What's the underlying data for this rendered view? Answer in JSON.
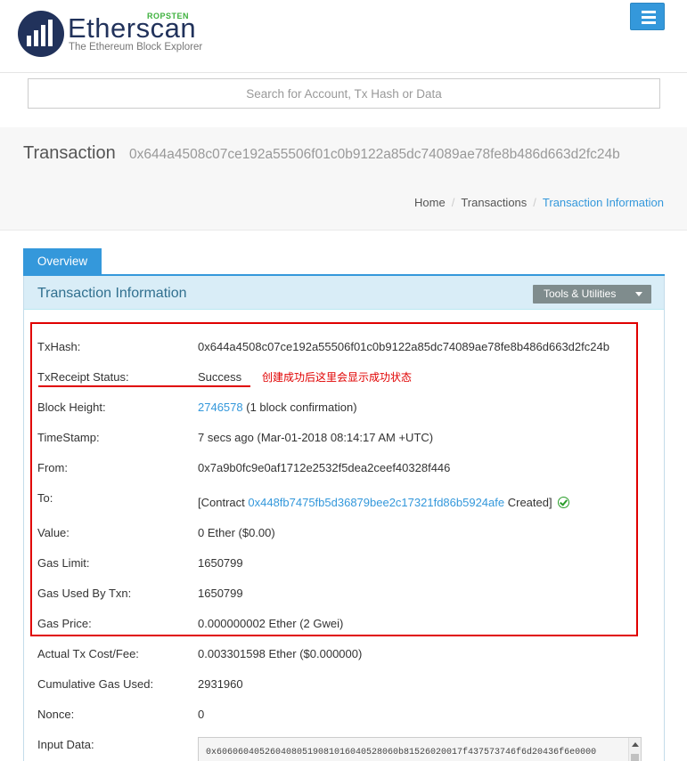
{
  "header": {
    "logo_text": "Etherscan",
    "network_badge": "ROPSTEN",
    "tagline": "The Ethereum Block Explorer"
  },
  "search": {
    "placeholder": "Search for Account, Tx Hash or Data"
  },
  "page": {
    "title": "Transaction",
    "hash": "0x644a4508c07ce192a55506f01c0b9122a85dc74089ae78fe8b486d663d2fc24b"
  },
  "breadcrumb": {
    "home": "Home",
    "transactions": "Transactions",
    "current": "Transaction Information",
    "separator": "/"
  },
  "tabs": {
    "overview": "Overview"
  },
  "panel": {
    "title": "Transaction Information",
    "tools_label": "Tools & Utilities"
  },
  "details": {
    "txhash": {
      "label": "TxHash:",
      "value": "0x644a4508c07ce192a55506f01c0b9122a85dc74089ae78fe8b486d663d2fc24b"
    },
    "status": {
      "label": "TxReceipt Status:",
      "value": "Success"
    },
    "block": {
      "label": "Block Height:",
      "value": "2746578",
      "suffix": "(1 block confirmation)"
    },
    "timestamp": {
      "label": "TimeStamp:",
      "value": "7 secs ago (Mar-01-2018 08:14:17 AM +UTC)"
    },
    "from": {
      "label": "From:",
      "value": "0x7a9b0fc9e0af1712e2532f5dea2ceef40328f446"
    },
    "to": {
      "label": "To:",
      "prefix": "[Contract",
      "value": "0x448fb7475fb5d36879bee2c17321fd86b5924afe",
      "suffix": "Created]"
    },
    "value": {
      "label": "Value:",
      "value": "0 Ether ($0.00)"
    },
    "gas_limit": {
      "label": "Gas Limit:",
      "value": "1650799"
    },
    "gas_used": {
      "label": "Gas Used By Txn:",
      "value": "1650799"
    },
    "gas_price": {
      "label": "Gas Price:",
      "value": "0.000000002 Ether (2 Gwei)"
    },
    "tx_cost": {
      "label": "Actual Tx Cost/Fee:",
      "value": "0.003301598 Ether ($0.000000)"
    },
    "cumulative_gas": {
      "label": "Cumulative Gas Used:",
      "value": "2931960"
    },
    "nonce": {
      "label": "Nonce:",
      "value": "0"
    },
    "input_data": {
      "label": "Input Data:",
      "value": "0x6060604052604080519081016040528060b81526020017f437573746f6d20436f6e0000"
    }
  },
  "annotation": {
    "note": "创建成功后这里会显示成功状态",
    "color": "#e00000"
  },
  "colors": {
    "brand_navy": "#21325b",
    "accent_blue": "#3498db",
    "success_green": "#008000",
    "panel_head_bg": "#d9edf7"
  }
}
